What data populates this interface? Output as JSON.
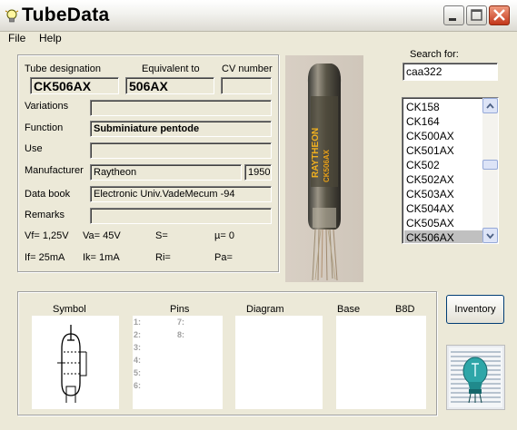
{
  "window": {
    "title": "TubeData"
  },
  "menu": {
    "items": [
      "File",
      "Help"
    ]
  },
  "fields": {
    "tube_designation_label": "Tube designation",
    "tube_designation": "CK506AX",
    "equivalent_label": "Equivalent to",
    "equivalent": "506AX",
    "cv_label": "CV number",
    "cv": "",
    "variations_label": "Variations",
    "variations": "",
    "function_label": "Function",
    "function": "Subminiature pentode",
    "use_label": "Use",
    "use": "",
    "manufacturer_label": "Manufacturer",
    "manufacturer": "Raytheon",
    "year": "1950",
    "databook_label": "Data book",
    "databook": "Electronic Univ.VadeMecum -94",
    "remarks_label": "Remarks",
    "remarks": ""
  },
  "params": {
    "vf": "Vf= 1,25V",
    "va": "Va=  45V",
    "s": "S=",
    "mu": "µ=    0",
    "if": "If= 25mA",
    "ik": "Ik=   1mA",
    "ri": "Ri=",
    "pa": "Pa="
  },
  "search": {
    "label": "Search for:",
    "value": "caa322"
  },
  "tube_list": {
    "items": [
      "CK158",
      "CK164",
      "CK500AX",
      "CK501AX",
      "CK502",
      "CK502AX",
      "CK503AX",
      "CK504AX",
      "CK505AX",
      "CK506AX"
    ],
    "selected": "CK506AX"
  },
  "bottom": {
    "symbol_label": "Symbol",
    "pins_label": "Pins",
    "diagram_label": "Diagram",
    "base_label": "Base",
    "base_value": "B8D",
    "pins_left": [
      "1:",
      "2:",
      "3:",
      "4:",
      "5:",
      "6:"
    ],
    "pins_right": [
      "7:",
      "8:"
    ]
  },
  "buttons": {
    "inventory": "Inventory"
  },
  "photo": {
    "tube_text_1": "RAYTHEON",
    "tube_text_2": "CK506AX"
  },
  "colors": {
    "window_bg": "#ece9d8",
    "close_btn": "#c3371b",
    "list_selected": "#c0c0c0"
  },
  "icons": [
    "lightbulb-icon",
    "minimize-icon",
    "maximize-icon",
    "close-icon",
    "scroll-up-icon",
    "scroll-down-icon",
    "pentode-symbol-icon",
    "tube-logo-icon"
  ]
}
